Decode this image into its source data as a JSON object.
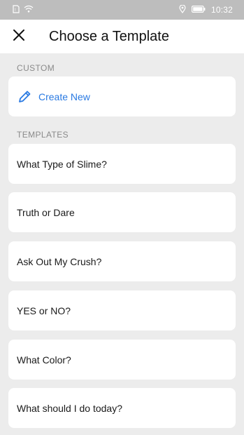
{
  "status_bar": {
    "time": "10:32",
    "icons": [
      "sim-icon",
      "wifi-icon",
      "location-icon",
      "battery-icon"
    ]
  },
  "app_bar": {
    "title": "Choose a Template",
    "close_icon": "close-icon"
  },
  "sections": {
    "custom_label": "CUSTOM",
    "templates_label": "TEMPLATES"
  },
  "custom": {
    "create_label": "Create New",
    "create_icon": "pencil-icon",
    "accent": "#2a7ae2"
  },
  "templates": [
    {
      "label": "What Type of Slime?"
    },
    {
      "label": "Truth or Dare"
    },
    {
      "label": "Ask Out My Crush?"
    },
    {
      "label": "YES or NO?"
    },
    {
      "label": "What Color?"
    },
    {
      "label": "What should I do today?"
    }
  ]
}
